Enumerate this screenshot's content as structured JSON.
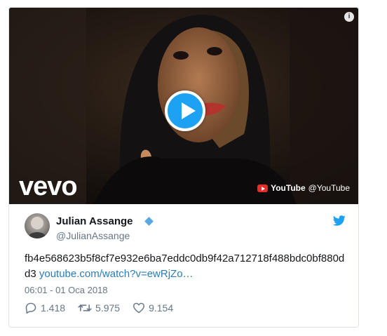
{
  "media": {
    "info_label": "i",
    "brand_logo": "vevo",
    "attribution": {
      "source": "YouTube",
      "handle": "@YouTube"
    },
    "play_icon": "play-icon"
  },
  "tweet": {
    "display_name": "Julian Assange",
    "handle": "@JulianAssange",
    "text": "fb4e568623b5f8cf7e932e6ba7eddc0db9f42a712718f488bdc0bf880dd3",
    "link": "youtube.com/watch?v=ewRjZo…",
    "timestamp": "06:01 - 01 Oca 2018",
    "actions": {
      "replies": "1.418",
      "retweets": "5.975",
      "likes": "9.154"
    }
  },
  "colors": {
    "accent": "#1da1f2",
    "link": "#2b7bb9",
    "muted": "#657786",
    "youtube_red": "#e52d27"
  }
}
